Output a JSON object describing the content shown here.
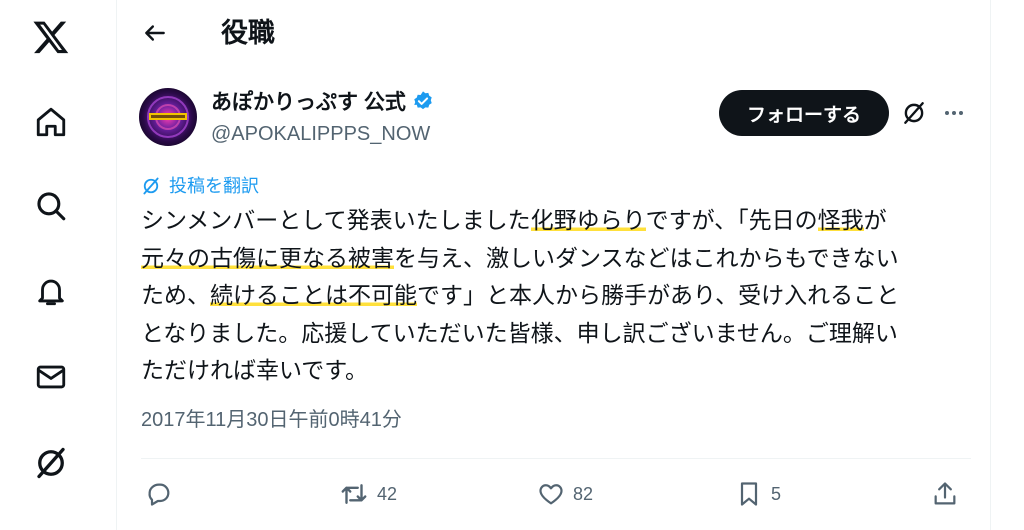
{
  "header": {
    "title": "役職",
    "back_icon": "arrow-left-icon"
  },
  "sidebar": {
    "items": [
      {
        "icon": "x-logo-icon"
      },
      {
        "icon": "home-icon"
      },
      {
        "icon": "search-icon"
      },
      {
        "icon": "bell-icon"
      },
      {
        "icon": "mail-icon"
      },
      {
        "icon": "grok-icon"
      }
    ]
  },
  "post": {
    "author_name": "あぽかりっぷす 公式",
    "handle": "@APOKALIPPPS_NOW",
    "verified_color": "#1d9bf0",
    "follow_label": "フォローする",
    "translate_label": "投稿を翻訳",
    "text": {
      "l1a": "シンメンバーとして発表いたしました",
      "l1b": "化野ゆらり",
      "l1c": "ですが、「先日の",
      "l1d": "怪我",
      "l1e": "が",
      "l2a": "元々の古傷に更なる被害",
      "l2b": "を与え、激しいダンスなどはこれからもできない",
      "l3a": "ため、",
      "l3b": "続けることは不可能",
      "l3c": "です」と本人から勝手があり、受け入れること",
      "l4": "となりました。応援していただいた皆様、申し訳ございません。ご理解い",
      "l5": "ただければ幸いです。"
    },
    "timestamp": "2017年11月30日午前0時41分",
    "reply_count": "",
    "repost_count": "42",
    "like_count": "82",
    "bookmark_count": "5",
    "highlight_color": "#ffe03b"
  }
}
